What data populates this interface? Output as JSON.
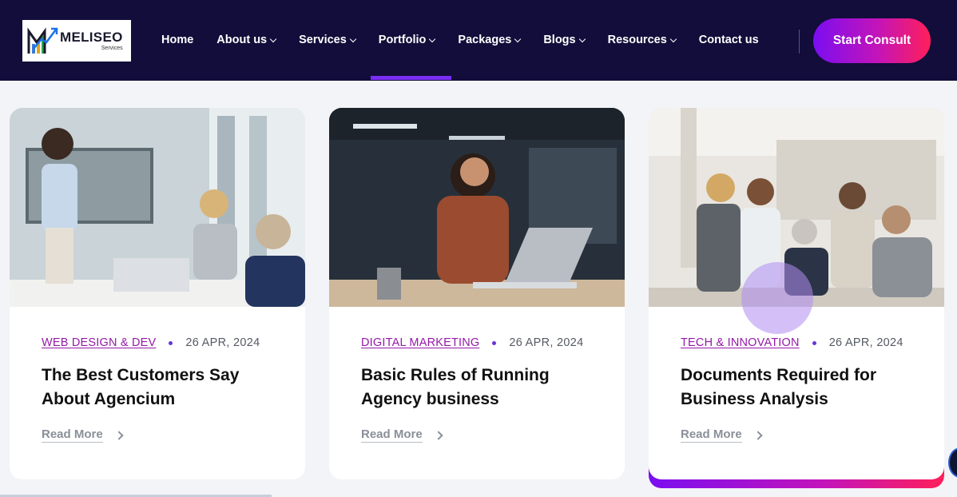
{
  "brand": {
    "name": "MELISEO",
    "sub": "Services",
    "logo_icon": "chart-arrow-logo-icon"
  },
  "nav": {
    "items": [
      {
        "label": "Home",
        "dropdown": false
      },
      {
        "label": "About us",
        "dropdown": true
      },
      {
        "label": "Services",
        "dropdown": true
      },
      {
        "label": "Portfolio",
        "dropdown": true
      },
      {
        "label": "Packages",
        "dropdown": true
      },
      {
        "label": "Blogs",
        "dropdown": true
      },
      {
        "label": "Resources",
        "dropdown": true
      },
      {
        "label": "Contact us",
        "dropdown": false
      }
    ],
    "active": "Portfolio",
    "cta_label": "Start Consult"
  },
  "posts": [
    {
      "category": "WEB DESIGN & DEV",
      "date": "26 APR, 2024",
      "title": "The Best Customers Say About Agencium",
      "read_more": "Read More",
      "image": "office-presentation-photo"
    },
    {
      "category": "DIGITAL MARKETING",
      "date": "26 APR, 2024",
      "title": "Basic Rules of Running Agency business",
      "read_more": "Read More",
      "image": "woman-on-phone-laptop-photo"
    },
    {
      "category": "TECH & INNOVATION",
      "date": "26 APR, 2024",
      "title": "Documents Required for Business Analysis",
      "read_more": "Read More",
      "image": "team-meeting-photo"
    }
  ],
  "colors": {
    "header_bg": "#120d3a",
    "accent_purple": "#7b2ff2",
    "category": "#9419a8",
    "cta_gradient": [
      "#7a0ef0",
      "#c414b9",
      "#ff1f5a"
    ]
  }
}
